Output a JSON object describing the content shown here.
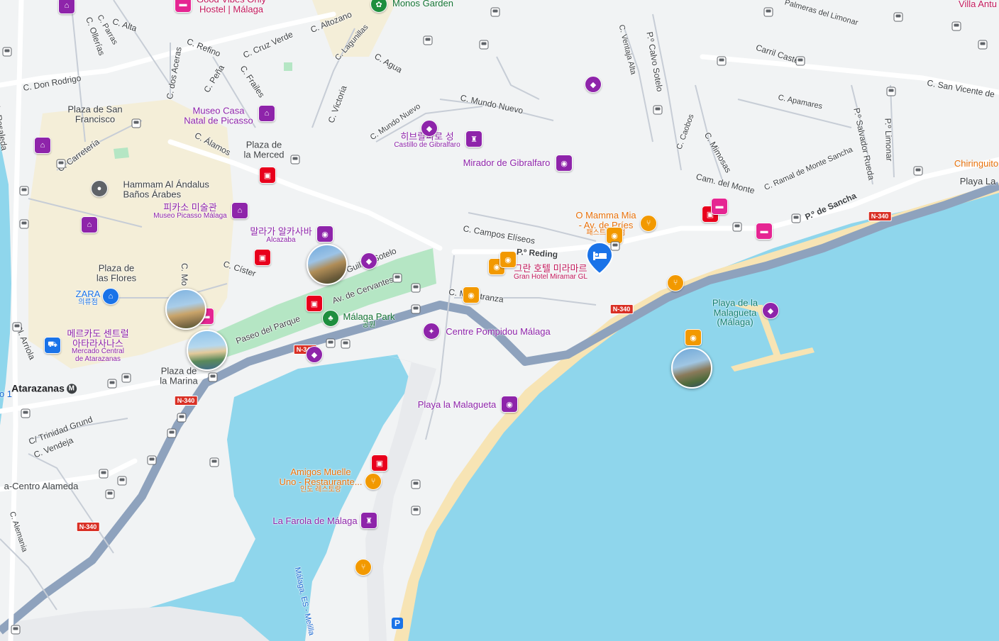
{
  "map": {
    "colors": {
      "water": "#8fd6ec",
      "land": "#f1f3f4",
      "sand": "#f7e4b4",
      "park": "#b5e6c4",
      "road": "#ffffff",
      "highway": "#8ea2bd",
      "minor": "#c7cdd6",
      "oldtown": "#f5ecd1"
    },
    "places": {
      "plaza_san_francisco": "Plaza de San\nFrancisco",
      "plaza_merced": "Plaza de\nla Merced",
      "plaza_flores": "Plaza de\nlas Flores",
      "plaza_marina": "Plaza de\nla Marina",
      "atarazanas": "Atarazanas",
      "metro_letter": "M",
      "centro_alameda": "a-Centro Alameda",
      "playa_malagueta_beach": "Playa de la\nMalagueta\n(Málaga)",
      "playa_la": "Playa La",
      "chiringuito": "Chiringuito",
      "villa": "Villa Antu",
      "edge_o1": "o 1"
    },
    "pois": {
      "good_vibes": "Good Vibes Only\nHostel | Málaga",
      "monos": "Monos Garden",
      "museo_casa": "Museo Casa\nNatal de Picasso",
      "hammam": "Hammam Al Ándalus\nBaños Árabes",
      "picasso_ko": "피카소 미술관",
      "picasso_es": "Museo Picasso Málaga",
      "alcazaba_ko": "말라가 알카사바",
      "alcazaba_es": "Alcazaba",
      "gibralfaro_ko": "히브랄파로 성",
      "gibralfaro_es": "Castillo de Gibralfaro",
      "mirador": "Mirador de Gibralfaro",
      "zara": "ZARA",
      "zara_sub": "의류점",
      "mercado_ko": "메르카도 센트럴\n아타라사나스",
      "mercado_es": "Mercado Central\nde Atarazanas",
      "malaga_park": "Málaga Park",
      "malaga_park_sub": "공원",
      "pompidou": "Centre Pompidou Málaga",
      "playa_malagueta": "Playa la Malagueta",
      "amigos": "Amigos Muelle\nUno - Restaurante...",
      "amigos_sub": "인도 레스토랑",
      "farola": "La Farola de Málaga",
      "mamma": "O Mamma Mia\n- Av. de Príes",
      "mamma_sub": "패스트푸드점",
      "hotel_ko": "그란 호텔 미라마르",
      "hotel_es": "Gran Hotel Miramar GL",
      "parking": "P"
    },
    "roads": {
      "alta": "C. Alta",
      "olleria": "C. Ollerías",
      "parras": "C. Parras",
      "refino": "C. Refino",
      "cruz_verde": "C. Cruz Verde",
      "altozano": "C. Altozano",
      "lagunillas": "C. Lagunillas",
      "don_rodrigo": "C. Don Rodrigo",
      "dos_aceras": "C. dos Aceras",
      "pena": "C. Peña",
      "frailes": "C. Frailes",
      "agua": "C. Agua",
      "victoria": "C. Victoria",
      "mundo_nuevo": "C. Mundo Nuevo",
      "mundo_nuevo2": "C. Mundo Nuevo",
      "rosaleda": "Av. de la Rosaleda",
      "carreteria": "C. Carretería",
      "alamos": "C. Álamos",
      "cister": "C. Císter",
      "mo": "C. Mo",
      "arriola": "Pl. Arriola",
      "guillen": "Guillén Sotelo",
      "cervantes": "Av. de Cervantes",
      "paseo_parque": "Paseo del Parque",
      "campos_eliseos": "C. Campos Elíseos",
      "reding": "P.º Reding",
      "maestranza": "C. Maestranza",
      "trinidad": "C/ Trinidad Grund",
      "vendeja": "C. Vendeja",
      "alemania": "C. Alemania",
      "ventaja": "C. Ventaja Alta",
      "calvo": "P.º Calvo Sotelo",
      "caobos": "C. Caobos",
      "mimosas": "C. Mimosas",
      "cam_monte": "Cam. del Monte",
      "ramal": "C. Ramal de Monte Sancha",
      "sancha": "P.º de Sancha",
      "salvador": "P.º Salvador Rueda",
      "limonar": "P.º Limonar",
      "apamares": "C. Apamares",
      "carril": "Carril Castell",
      "palmeras": "Palmeras del Limonar",
      "san_vicente": "C. San Vicente de",
      "melilla": "Málaga, ES - Melilla"
    },
    "shields": {
      "n340": "N-340"
    }
  }
}
